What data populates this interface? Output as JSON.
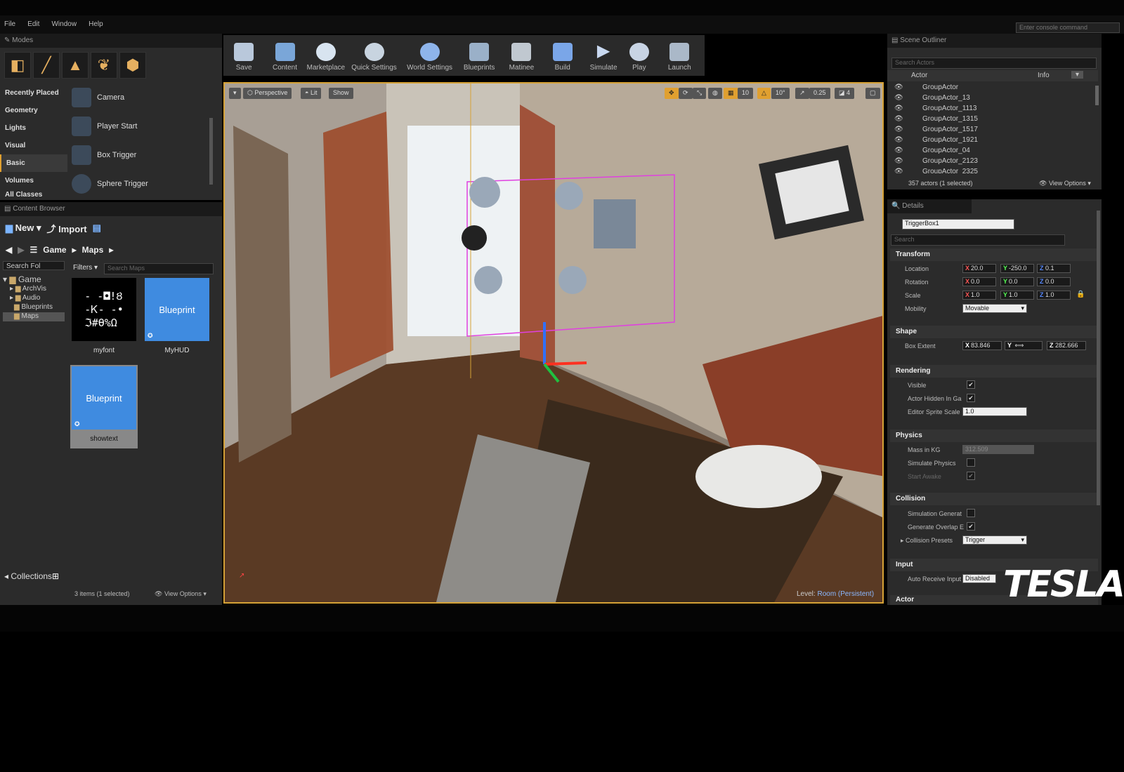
{
  "menu": [
    "File",
    "Edit",
    "Window",
    "Help"
  ],
  "console_placeholder": "Enter console command",
  "modes": {
    "tab": "Modes",
    "categories": [
      "Recently Placed",
      "Geometry",
      "Lights",
      "Visual",
      "Basic",
      "Volumes",
      "All Classes"
    ],
    "items": [
      "Camera",
      "Player Start",
      "Box Trigger",
      "Sphere Trigger"
    ]
  },
  "content_browser": {
    "tab": "Content Browser",
    "new_label": "New",
    "import_label": "Import",
    "breadcrumb": [
      "Game",
      "Maps"
    ],
    "search_folders_placeholder": "Search Fol",
    "filters_label": "Filters",
    "search_maps_placeholder": "Search Maps",
    "tree": [
      "Game",
      "ArchVis",
      "Audio",
      "Blueprints",
      "Maps"
    ],
    "assets": [
      {
        "name": "myfont",
        "thumb": ""
      },
      {
        "name": "MyHUD",
        "thumb": "Blueprint"
      },
      {
        "name": "showtext",
        "thumb": "Blueprint"
      }
    ],
    "collections_label": "Collections",
    "status": "3 items (1 selected)",
    "view_options": "View Options"
  },
  "toolbar": [
    "Save",
    "Content",
    "Marketplace",
    "Quick Settings",
    "World Settings",
    "Blueprints",
    "Matinee",
    "Build",
    "Simulate",
    "Play",
    "Launch"
  ],
  "viewport": {
    "perspective": "Perspective",
    "lit": "Lit",
    "show": "Show",
    "grid_snap": "10",
    "rot_snap": "10°",
    "scale_snap": "0.25",
    "camera_speed": "4",
    "level_label": "Level:",
    "level_name": "Room (Persistent)"
  },
  "outliner": {
    "tab": "Scene Outliner",
    "search_placeholder": "Search Actors",
    "col_actor": "Actor",
    "col_info": "Info",
    "actors": [
      "GroupActor",
      "GroupActor_13",
      "GroupActor_1113",
      "GroupActor_1315",
      "GroupActor_1517",
      "GroupActor_1921",
      "GroupActor_04",
      "GroupActor_2123",
      "GroupActor_2325"
    ],
    "count": "357 actors (1 selected)",
    "view_options": "View Options"
  },
  "details": {
    "tab": "Details",
    "name": "TriggerBox1",
    "search_placeholder": "Search",
    "transform": {
      "title": "Transform",
      "location_label": "Location",
      "location": [
        "20.0",
        "-250.0",
        "0.1"
      ],
      "rotation_label": "Rotation",
      "rotation": [
        "0.0",
        "0.0",
        "0.0"
      ],
      "scale_label": "Scale",
      "scale": [
        "1.0",
        "1.0",
        "1.0"
      ],
      "mobility_label": "Mobility",
      "mobility": "Movable"
    },
    "shape": {
      "title": "Shape",
      "box_extent_label": "Box Extent",
      "box_extent": [
        "83.846",
        "",
        "282.666"
      ]
    },
    "rendering": {
      "title": "Rendering",
      "visible": "Visible",
      "hidden": "Actor Hidden In Ga",
      "sprite_label": "Editor Sprite Scale",
      "sprite": "1.0"
    },
    "physics": {
      "title": "Physics",
      "mass_label": "Mass in KG",
      "mass": "312.509",
      "simulate": "Simulate Physics",
      "awake": "Start Awake"
    },
    "collision": {
      "title": "Collision",
      "sim_gen": "Simulation Generat",
      "gen_overlap": "Generate Overlap E",
      "presets_label": "Collision Presets",
      "presets": "Trigger"
    },
    "input": {
      "title": "Input",
      "auto_label": "Auto Receive Input",
      "auto": "Disabled"
    },
    "actor": {
      "title": "Actor"
    }
  },
  "watermark": "TESLA"
}
